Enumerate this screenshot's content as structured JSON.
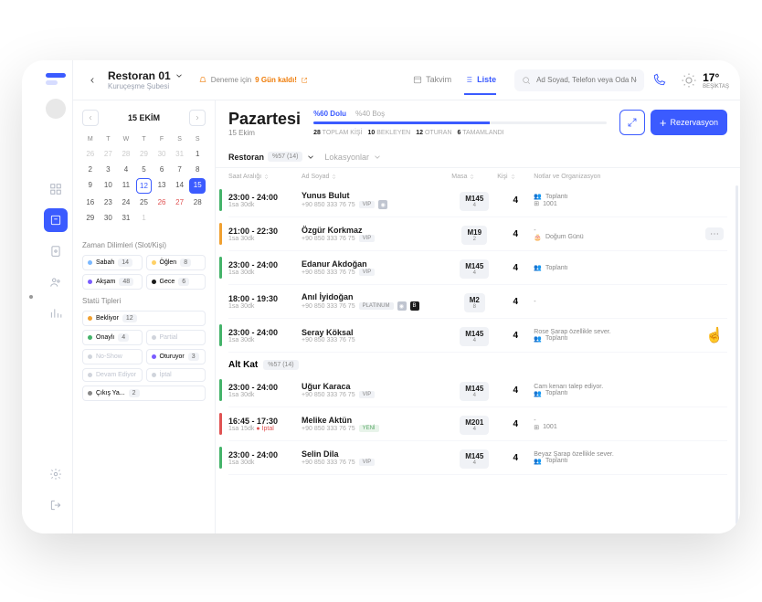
{
  "header": {
    "restaurant": "Restoran 01",
    "branch": "Kuruçeşme Şubesi",
    "trial_label": "Deneme için",
    "trial_days": "9 Gün kaldı!",
    "view_calendar": "Takvim",
    "view_list": "Liste",
    "search_placeholder": "Ad Soyad, Telefon veya Oda No",
    "weather_temp": "17°",
    "weather_loc": "BEŞİKTAŞ"
  },
  "calendar": {
    "month_label": "15  EKİM",
    "weekdays": [
      "M",
      "T",
      "W",
      "T",
      "F",
      "S",
      "S"
    ],
    "weeks": [
      [
        {
          "d": "26",
          "m": true
        },
        {
          "d": "27",
          "m": true
        },
        {
          "d": "28",
          "m": true
        },
        {
          "d": "29",
          "m": true
        },
        {
          "d": "30",
          "m": true
        },
        {
          "d": "31",
          "m": true
        },
        {
          "d": "1"
        }
      ],
      [
        {
          "d": "2"
        },
        {
          "d": "3"
        },
        {
          "d": "4"
        },
        {
          "d": "5"
        },
        {
          "d": "6"
        },
        {
          "d": "7"
        },
        {
          "d": "8"
        }
      ],
      [
        {
          "d": "9"
        },
        {
          "d": "10"
        },
        {
          "d": "11"
        },
        {
          "d": "12",
          "today": true
        },
        {
          "d": "13"
        },
        {
          "d": "14"
        },
        {
          "d": "15",
          "selected": true
        }
      ],
      [
        {
          "d": "16"
        },
        {
          "d": "23"
        },
        {
          "d": "24"
        },
        {
          "d": "25"
        },
        {
          "d": "26",
          "red": true
        },
        {
          "d": "27",
          "red": true
        },
        {
          "d": "28"
        },
        {
          "d": "29"
        }
      ],
      [
        {
          "d": "30"
        },
        {
          "d": "31"
        },
        {
          "d": "1",
          "m": true
        },
        {
          "d": "",
          "m": true
        },
        {
          "d": "",
          "m": true
        },
        {
          "d": "",
          "m": true
        },
        {
          "d": "",
          "m": true
        }
      ]
    ],
    "slots_label": "Zaman Dilimleri (Slot/Kişi)",
    "slots": [
      {
        "name": "Sabah",
        "count": "14",
        "color": "#7bb8ff"
      },
      {
        "name": "Öğlen",
        "count": "8",
        "color": "#ffd166"
      },
      {
        "name": "Akşam",
        "count": "48",
        "color": "#7a5cff"
      },
      {
        "name": "Gece",
        "count": "6",
        "color": "#1a1a1a"
      }
    ],
    "status_label": "Statü Tipleri",
    "statuses": [
      {
        "name": "Bekliyor",
        "count": "12",
        "color": "#f0a030",
        "active": true
      },
      {
        "name": "Onaylı",
        "count": "4",
        "color": "#44b36a",
        "active": true
      },
      {
        "name": "Partial",
        "muted": true
      },
      {
        "name": "No-Show",
        "muted": true
      },
      {
        "name": "Oturuyor",
        "count": "3",
        "color": "#7a5cff",
        "active": true
      },
      {
        "name": "Devam Ediyor",
        "muted": true
      },
      {
        "name": "İptal",
        "muted": true
      },
      {
        "name": "Çıkış Ya...",
        "count": "2",
        "color": "#888",
        "active": true
      }
    ]
  },
  "content": {
    "day": "Pazartesi",
    "date": "15 Ekim",
    "occupancy_full": "%60 Dolu",
    "occupancy_empty": "%40 Boş",
    "totals": [
      {
        "n": "28",
        "l": "TOPLAM KİŞİ"
      },
      {
        "n": "10",
        "l": "BEKLEYEN"
      },
      {
        "n": "12",
        "l": "OTURAN"
      },
      {
        "n": "6",
        "l": "TAMAMLANDI"
      }
    ],
    "reservation_btn": "Rezervasyon",
    "tab_main": "Restoran",
    "tab_main_pct": "%57 (14)",
    "tab_locations": "Lokasyonlar",
    "cols": {
      "time": "Saat Aralığı",
      "name": "Ad Soyad",
      "table": "Masa",
      "ppl": "Kişi",
      "notes": "Notlar ve Organizasyon"
    },
    "rows": [
      {
        "bar": "#44b36a",
        "time": "23:00 - 24:00",
        "dur": "1sa 30dk",
        "name": "Yunus Bulut",
        "phone": "+90 850 333 76 75",
        "tags": [
          "VIP"
        ],
        "icons": [
          "cam"
        ],
        "table": "M145",
        "cap": "4",
        "ppl": "4",
        "notes": [
          {
            "icon": "people",
            "text": "Toplantı"
          },
          {
            "icon": "table",
            "text": "1001"
          }
        ]
      },
      {
        "bar": "#f0a030",
        "time": "21:00 - 22:30",
        "dur": "1sa 30dk",
        "name": "Özgür Korkmaz",
        "phone": "+90 850 333 76 75",
        "tags": [
          "VIP"
        ],
        "table": "M19",
        "cap": "2",
        "ppl": "4",
        "notes": [
          {
            "text": "-"
          },
          {
            "icon": "cake",
            "text": "Doğum Günü"
          }
        ],
        "more": true
      },
      {
        "bar": "#44b36a",
        "time": "23:00 - 24:00",
        "dur": "1sa 30dk",
        "name": "Edanur Akdoğan",
        "phone": "+90 850 333 76 75",
        "tags": [
          "VIP"
        ],
        "table": "M145",
        "cap": "4",
        "ppl": "4",
        "notes": [
          {
            "icon": "people",
            "text": "Toplantı"
          }
        ]
      },
      {
        "bar": "",
        "time": "18:00 - 19:30",
        "dur": "1sa 30dk",
        "name": "Anıl İyidoğan",
        "phone": "+90 850 333 76 75",
        "tags": [
          "PLATINUM"
        ],
        "icons": [
          "cam",
          "B"
        ],
        "table": "M2",
        "cap": "8",
        "ppl": "4",
        "notes": [
          {
            "text": "-"
          }
        ]
      },
      {
        "bar": "#44b36a",
        "time": "23:00 - 24:00",
        "dur": "1sa 30dk",
        "name": "Seray Köksal",
        "phone": "+90 850 333 76 75",
        "table": "M145",
        "cap": "4",
        "ppl": "4",
        "notes": [
          {
            "text": "Rose Şarap özellikle sever."
          },
          {
            "icon": "people",
            "text": "Toplantı"
          }
        ],
        "cursor": true
      }
    ],
    "sub_section": "Alt Kat",
    "sub_section_pct": "%57 (14)",
    "rows2": [
      {
        "bar": "#44b36a",
        "time": "23:00 - 24:00",
        "dur": "1sa 30dk",
        "name": "Uğur Karaca",
        "phone": "+90 850 333 76 75",
        "tags": [
          "VIP"
        ],
        "table": "M145",
        "cap": "4",
        "ppl": "4",
        "notes": [
          {
            "text": "Cam kenarı talep ediyor."
          },
          {
            "icon": "people",
            "text": "Toplantı"
          }
        ]
      },
      {
        "bar": "#e05252",
        "time": "16:45 - 17:30",
        "dur": "1sa 15dk",
        "dur_extra": "İptal",
        "name": "Melike Aktün",
        "phone": "+90 850 333 76 75",
        "tags": [
          "YENİ"
        ],
        "table": "M201",
        "cap": "4",
        "ppl": "4",
        "notes": [
          {
            "text": "-"
          },
          {
            "icon": "table",
            "text": "1001"
          }
        ]
      },
      {
        "bar": "#44b36a",
        "time": "23:00 - 24:00",
        "dur": "1sa 30dk",
        "name": "Selin Dila",
        "phone": "+90 850 333 76 75",
        "tags": [
          "VIP"
        ],
        "table": "M145",
        "cap": "4",
        "ppl": "4",
        "notes": [
          {
            "text": "Beyaz Şarap özellikle sever."
          },
          {
            "icon": "people",
            "text": "Toplantı"
          }
        ]
      }
    ]
  }
}
